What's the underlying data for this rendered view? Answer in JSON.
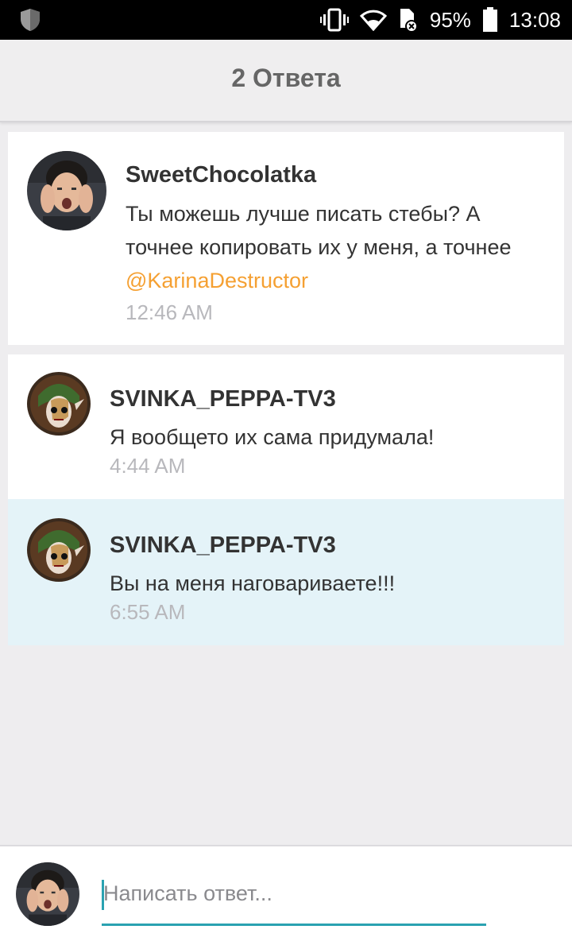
{
  "status_bar": {
    "battery": "95%",
    "time": "13:08",
    "icons": [
      "shield-icon",
      "vibrate-icon",
      "wifi-icon",
      "sd-card-error-icon",
      "battery-icon"
    ]
  },
  "header": {
    "title": "2 Ответа"
  },
  "comments": [
    {
      "username": "SweetChocolatka",
      "text_lines": [
        "Ты можешь лучше писать стебы? А",
        "точнее копировать их у меня, а точнее"
      ],
      "mention": "@KarinaDestructor",
      "time": "12:46 AM"
    },
    {
      "username": "SVINKA_PEPPA-TV3",
      "text": "Я вообщето их сама придумала!",
      "time": "4:44 AM"
    },
    {
      "username": "SVINKA_PEPPA-TV3",
      "text": "Вы на меня наговариваете!!!",
      "time": "6:55 AM",
      "highlighted": true
    }
  ],
  "composer": {
    "placeholder": "Написать ответ...",
    "send_icon": "send-icon"
  },
  "colors": {
    "accent": "#2aa2b1",
    "mention": "#f5a032",
    "highlight_bg": "#e4f3f8"
  }
}
